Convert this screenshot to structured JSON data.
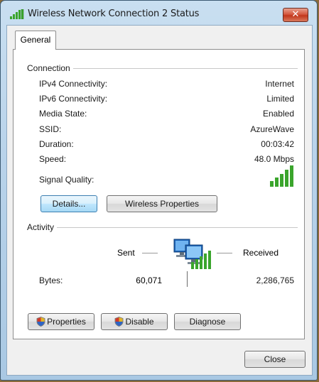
{
  "window": {
    "title": "Wireless Network Connection 2 Status",
    "close_glyph": "✕"
  },
  "tabs": [
    {
      "label": "General"
    }
  ],
  "connection": {
    "heading": "Connection",
    "rows": [
      {
        "label": "IPv4 Connectivity:",
        "value": "Internet"
      },
      {
        "label": "IPv6 Connectivity:",
        "value": "Limited"
      },
      {
        "label": "Media State:",
        "value": "Enabled"
      },
      {
        "label": "SSID:",
        "value": "AzureWave"
      },
      {
        "label": "Duration:",
        "value": "00:03:42"
      },
      {
        "label": "Speed:",
        "value": "48.0 Mbps"
      }
    ],
    "signal_label": "Signal Quality:",
    "signal_bars_lit": 5,
    "signal_bars_total": 5,
    "details_button": "Details...",
    "wireless_properties_button": "Wireless Properties"
  },
  "activity": {
    "heading": "Activity",
    "sent_label": "Sent",
    "received_label": "Received",
    "bytes_label": "Bytes:",
    "bytes_sent": "60,071",
    "bytes_received": "2,286,765",
    "properties_button": "Properties",
    "disable_button": "Disable",
    "diagnose_button": "Diagnose"
  },
  "footer": {
    "close_button": "Close"
  },
  "icons": {
    "title_icon": "wireless-signal-icon",
    "signal_icon": "signal-strength-icon",
    "network_icon": "network-computers-icon",
    "button_icon": "uac-shield-icon"
  },
  "colors": {
    "signal_green": "#3aa52c",
    "accent_blue": "#3c7fb1",
    "close_red": "#c2371c"
  }
}
